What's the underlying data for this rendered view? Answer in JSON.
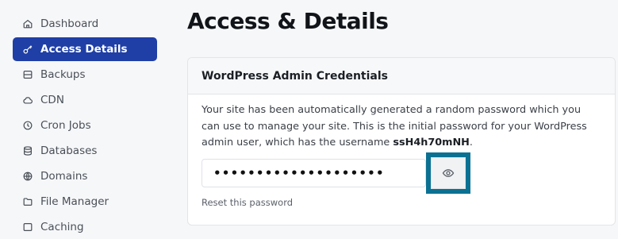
{
  "sidebar": {
    "items": [
      {
        "label": "Dashboard",
        "icon": "home-icon",
        "active": false
      },
      {
        "label": "Access Details",
        "icon": "key-icon",
        "active": true
      },
      {
        "label": "Backups",
        "icon": "backup-icon",
        "active": false
      },
      {
        "label": "CDN",
        "icon": "cloud-icon",
        "active": false
      },
      {
        "label": "Cron Jobs",
        "icon": "clock-icon",
        "active": false
      },
      {
        "label": "Databases",
        "icon": "database-icon",
        "active": false
      },
      {
        "label": "Domains",
        "icon": "globe-icon",
        "active": false
      },
      {
        "label": "File Manager",
        "icon": "folder-icon",
        "active": false
      },
      {
        "label": "Caching",
        "icon": "caching-icon",
        "active": false
      }
    ]
  },
  "main": {
    "title": "Access & Details",
    "card": {
      "title": "WordPress Admin Credentials",
      "text_before": "Your site has been automatically generated a random password which you can use to manage your site. This is the initial password for your WordPress admin user, which has the username ",
      "username": "ssH4h70mNH",
      "text_after": ".",
      "password_masked": "••••••••••••••••••••",
      "reveal_icon": "eye-icon",
      "reset_link": "Reset this password"
    }
  },
  "colors": {
    "accent": "#1f3fa6",
    "highlight": "#0b7193"
  }
}
